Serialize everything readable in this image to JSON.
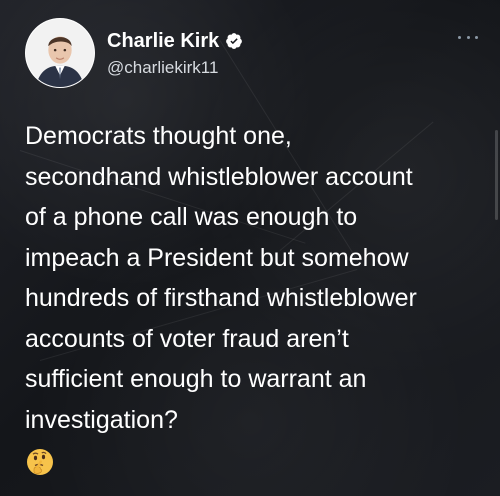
{
  "author": {
    "display_name": "Charlie Kirk",
    "handle": "@charliekirk11",
    "avatar_icon": "avatar-photo",
    "verified_icon": "verified-badge-icon"
  },
  "tweet": {
    "lines": [
      "Democrats thought one,",
      "secondhand whistleblower account",
      "of a phone call was enough to",
      "impeach a President but somehow",
      "hundreds of firsthand whistleblower",
      "accounts of voter fraud aren’t",
      "sufficient enough to warrant an",
      "investigation?"
    ],
    "emoji": "🤔"
  },
  "colors": {
    "background": "#16181d",
    "text": "#ffffff",
    "handle": "#d7dbe0",
    "verified_badge": "#ffffff",
    "more_dots": "#8b98a5"
  },
  "icons": {
    "more": "more-options-icon",
    "emoji": "thinking-face-icon"
  }
}
